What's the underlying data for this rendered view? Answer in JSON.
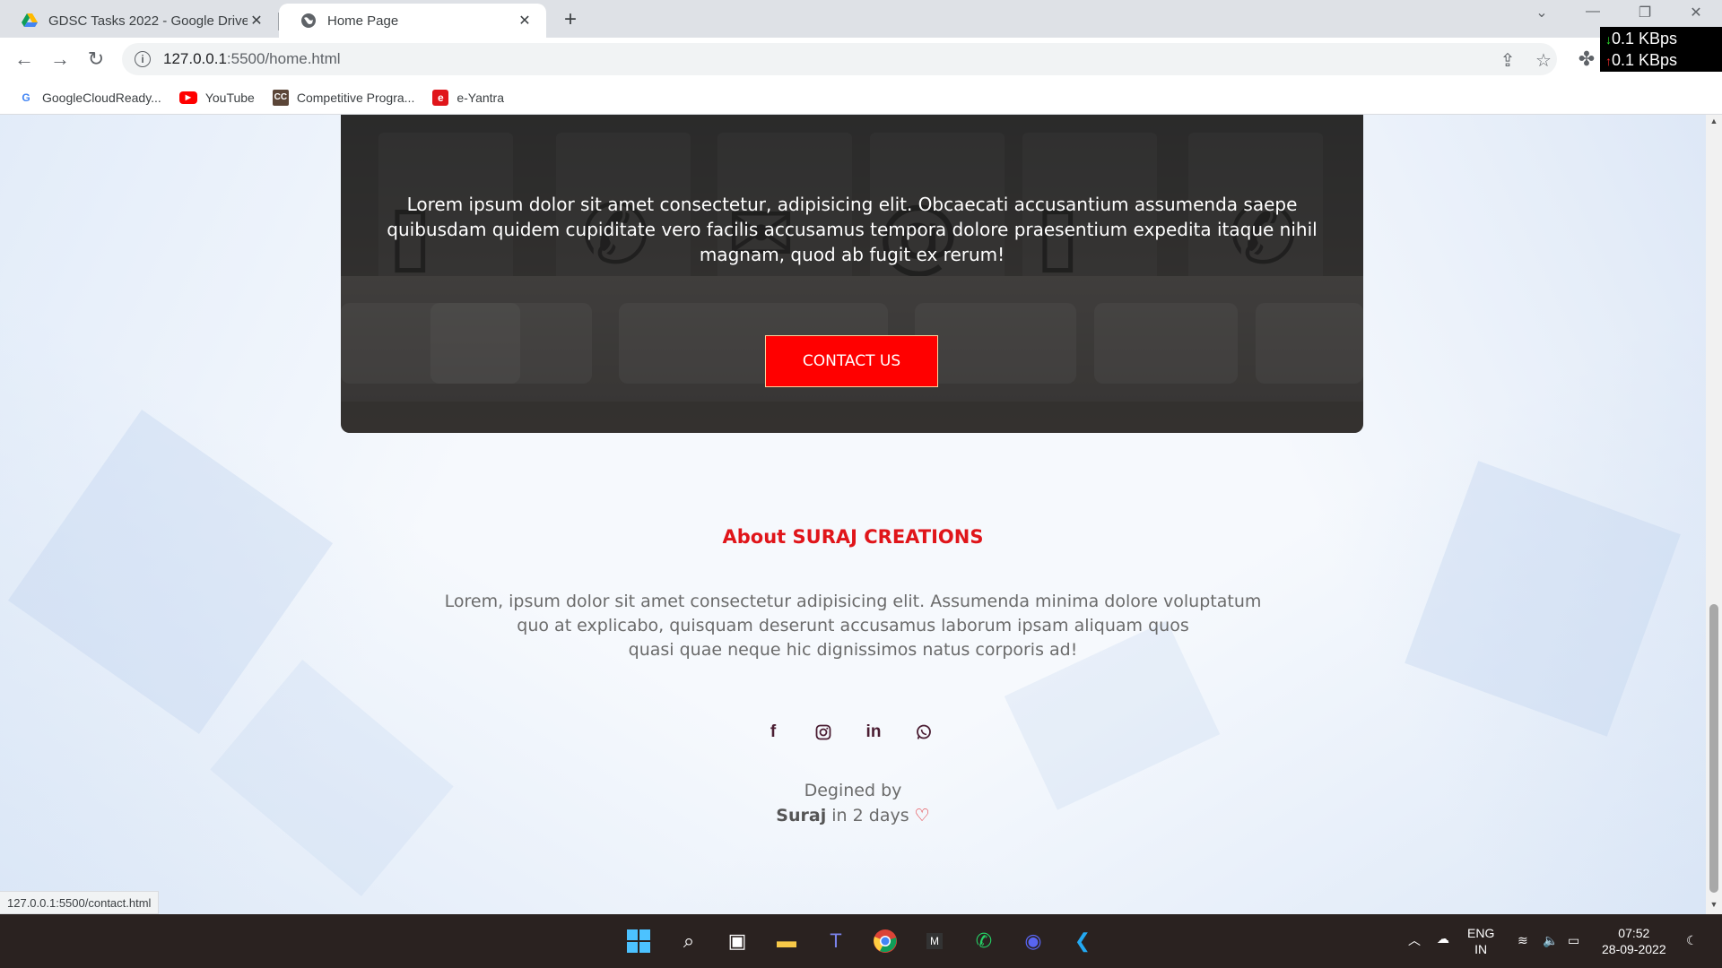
{
  "browser": {
    "tabs": [
      {
        "title": "GDSC Tasks 2022 - Google Drive",
        "icon": "google-drive-icon",
        "active": false
      },
      {
        "title": "Home Page",
        "icon": "globe-icon",
        "active": true
      }
    ],
    "url_host": "127.0.0.1",
    "url_rest": ":5500/home.html",
    "bookmarks": [
      {
        "label": "GoogleCloudReady...",
        "icon": "google-icon"
      },
      {
        "label": "YouTube",
        "icon": "youtube-icon"
      },
      {
        "label": "Competitive Progra...",
        "icon": "cc-icon"
      },
      {
        "label": "e-Yantra",
        "icon": "e-yantra-icon"
      }
    ],
    "status_url": "127.0.0.1:5500/contact.html"
  },
  "netmon": {
    "down": "0.1 KBps",
    "up": "0.1 KBps"
  },
  "page": {
    "hero_text": "Lorem ipsum dolor sit amet consectetur, adipisicing elit. Obcaecati accusantium assumenda saepe quibusdam quidem cupiditate vero facilis accusamus tempora dolore praesentium expedita itaque nihil magnam, quod ab fugit ex rerum!",
    "contact_button": "CONTACT US",
    "about_prefix": "About",
    "about_brand": "SURAJ CREATIONS",
    "about_lines": [
      "Lorem, ipsum dolor sit amet consectetur adipisicing elit. Assumenda minima dolore voluptatum",
      "quo at explicabo, quisquam deserunt accusamus laborum ipsam aliquam quos",
      "quasi quae neque hic dignissimos natus corporis ad!"
    ],
    "socials": [
      "facebook-icon",
      "instagram-icon",
      "linkedin-icon",
      "whatsapp-icon"
    ],
    "credit_line1": "Degined by",
    "credit_name": "Suraj",
    "credit_rest": "in 2 days",
    "accent_color": "#ff0000"
  },
  "taskbar": {
    "lang_top": "ENG",
    "lang_bottom": "IN",
    "time": "07:52",
    "date": "28-09-2022"
  }
}
